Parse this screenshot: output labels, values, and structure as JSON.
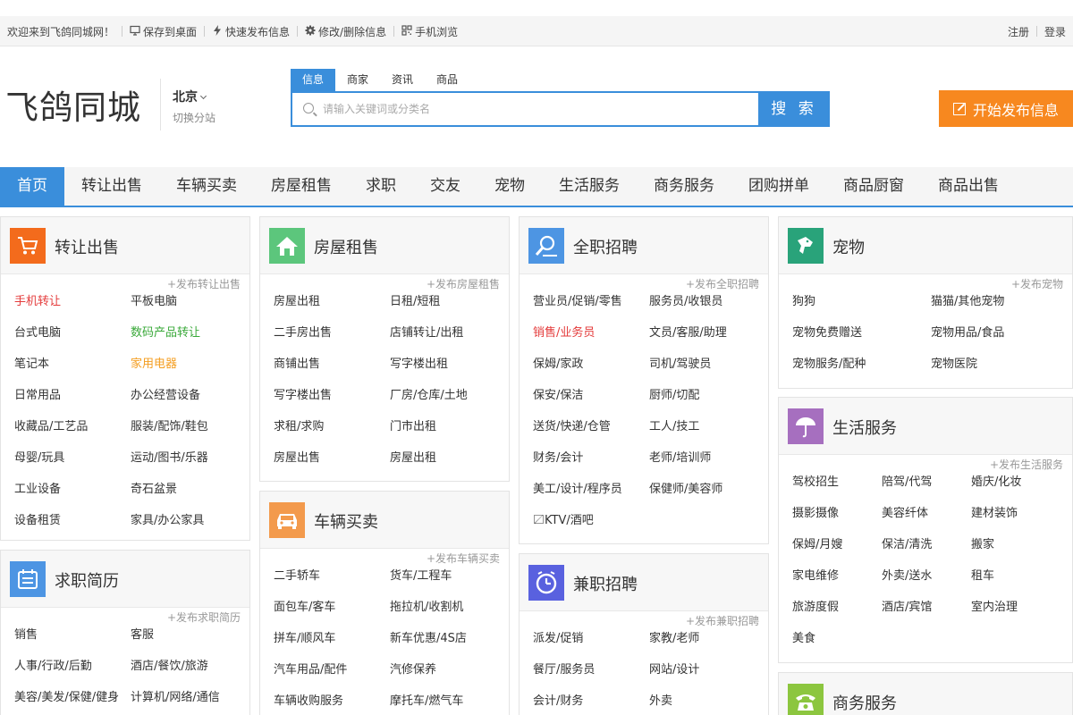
{
  "topbar": {
    "welcome": "欢迎来到飞鸽同城网！",
    "save_desktop": "保存到桌面",
    "quick_post": "快速发布信息",
    "edit_delete": "修改/删除信息",
    "mobile": "手机浏览",
    "register": "注册",
    "login": "登录"
  },
  "header": {
    "logo": "飞鸽同城",
    "city": "北京",
    "switch_city": "切换分站",
    "search_tabs": [
      "信息",
      "商家",
      "资讯",
      "商品"
    ],
    "search_placeholder": "请输入关键词或分类名",
    "search_button": "搜 索",
    "post_button": "开始发布信息"
  },
  "nav": [
    "首页",
    "转让出售",
    "车辆买卖",
    "房屋租售",
    "求职",
    "交友",
    "宠物",
    "生活服务",
    "商务服务",
    "团购拼单",
    "商品厨窗",
    "商品出售"
  ],
  "colors": {
    "accent": "#3a8edb",
    "post_button": "#f7881f",
    "highlight_red": "#e43b3b",
    "highlight_green": "#3aa93a",
    "highlight_orange": "#f49d1f"
  },
  "cards": {
    "transfer": {
      "title": "转让出售",
      "icon": "shopping-cart-icon",
      "color": "#f36b1c",
      "post": "+发布转让出售",
      "items": [
        "手机转让",
        "平板电脑",
        "台式电脑",
        "数码产品转让",
        "笔记本",
        "家用电器",
        "日常用品",
        "办公经营设备",
        "收藏品/工艺品",
        "服装/配饰/鞋包",
        "母婴/玩具",
        "运动/图书/乐器",
        "工业设备",
        "奇石盆景",
        "设备租赁",
        "家具/办公家具"
      ]
    },
    "resume": {
      "title": "求职简历",
      "icon": "calendar-icon",
      "color": "#4d95e3",
      "post": "+发布求职简历",
      "items": [
        "销售",
        "客服",
        "人事/行政/后勤",
        "酒店/餐饮/旅游",
        "美容/美发/保健/健身",
        "计算机/网络/通信"
      ]
    },
    "house": {
      "title": "房屋租售",
      "icon": "house-icon",
      "color": "#5cc67c",
      "post": "+发布房屋租售",
      "items": [
        "房屋出租",
        "日租/短租",
        "二手房出售",
        "店铺转让/出租",
        "商铺出售",
        "写字楼出租",
        "写字楼出售",
        "厂房/仓库/土地",
        "求租/求购",
        "门市出租",
        "房屋出售",
        "房屋出租"
      ]
    },
    "vehicle": {
      "title": "车辆买卖",
      "icon": "car-icon",
      "color": "#f39a4c",
      "post": "+发布车辆买卖",
      "items": [
        "二手轿车",
        "货车/工程车",
        "面包车/客车",
        "拖拉机/收割机",
        "拼车/顺风车",
        "新车优惠/4S店",
        "汽车用品/配件",
        "汽修保养",
        "车辆收购服务",
        "摩托车/燃气车"
      ]
    },
    "fulltime": {
      "title": "全职招聘",
      "icon": "person-search-icon",
      "color": "#4d95e3",
      "post": "+发布全职招聘",
      "items": [
        "营业员/促销/零售",
        "服务员/收银员",
        "销售/业务员",
        "文员/客服/助理",
        "保姆/家政",
        "司机/驾驶员",
        "保安/保洁",
        "厨师/切配",
        "送货/快递/仓管",
        "工人/技工",
        "财务/会计",
        "老师/培训师",
        "美工/设计/程序员",
        "保健师/美容师",
        "〼KTV/酒吧"
      ]
    },
    "parttime": {
      "title": "兼职招聘",
      "icon": "clock-icon",
      "color": "#5961df",
      "post": "+发布兼职招聘",
      "items": [
        "派发/促销",
        "家教/老师",
        "餐厅/服务员",
        "网站/设计",
        "会计/财务",
        "外卖"
      ]
    },
    "pet": {
      "title": "宠物",
      "icon": "dog-icon",
      "color": "#29a37a",
      "post": "+发布宠物",
      "items": [
        "狗狗",
        "猫猫/其他宠物",
        "宠物免费赠送",
        "宠物用品/食品",
        "宠物服务/配种",
        "宠物医院"
      ]
    },
    "life": {
      "title": "生活服务",
      "icon": "umbrella-icon",
      "color": "#a66fbf",
      "post": "+发布生活服务",
      "items": [
        "驾校招生",
        "陪驾/代驾",
        "婚庆/化妆",
        "摄影摄像",
        "美容纤体",
        "建材装饰",
        "保姆/月嫂",
        "保洁/清洗",
        "搬家",
        "家电维修",
        "外卖/送水",
        "租车",
        "旅游度假",
        "酒店/宾馆",
        "室内治理",
        "美食"
      ]
    },
    "business": {
      "title": "商务服务",
      "icon": "telephone-icon",
      "color": "#8cc63f"
    }
  }
}
